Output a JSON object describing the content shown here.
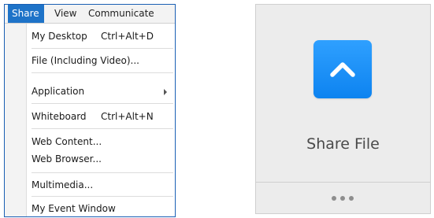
{
  "menubar": {
    "items": [
      "Share",
      "View",
      "Communicate"
    ],
    "active": "Share"
  },
  "share_menu": {
    "items": [
      {
        "label": "My Desktop",
        "shortcut": "Ctrl+Alt+D"
      },
      {
        "label": "File (Including Video)..."
      },
      {
        "label": "Application",
        "has_submenu": true
      },
      {
        "label": "Whiteboard",
        "shortcut": "Ctrl+Alt+N"
      },
      {
        "label": "Web Content..."
      },
      {
        "label": "Web Browser..."
      },
      {
        "label": "Multimedia..."
      },
      {
        "label": "My Event Window"
      }
    ]
  },
  "share_file_card": {
    "title": "Share File",
    "icon": "chevron-up-icon",
    "more_icon": "more-dots-icon"
  },
  "colors": {
    "menu_highlight": "#1e73c8",
    "tile_blue": "#1a8ef8",
    "card_bg": "#ececec"
  }
}
